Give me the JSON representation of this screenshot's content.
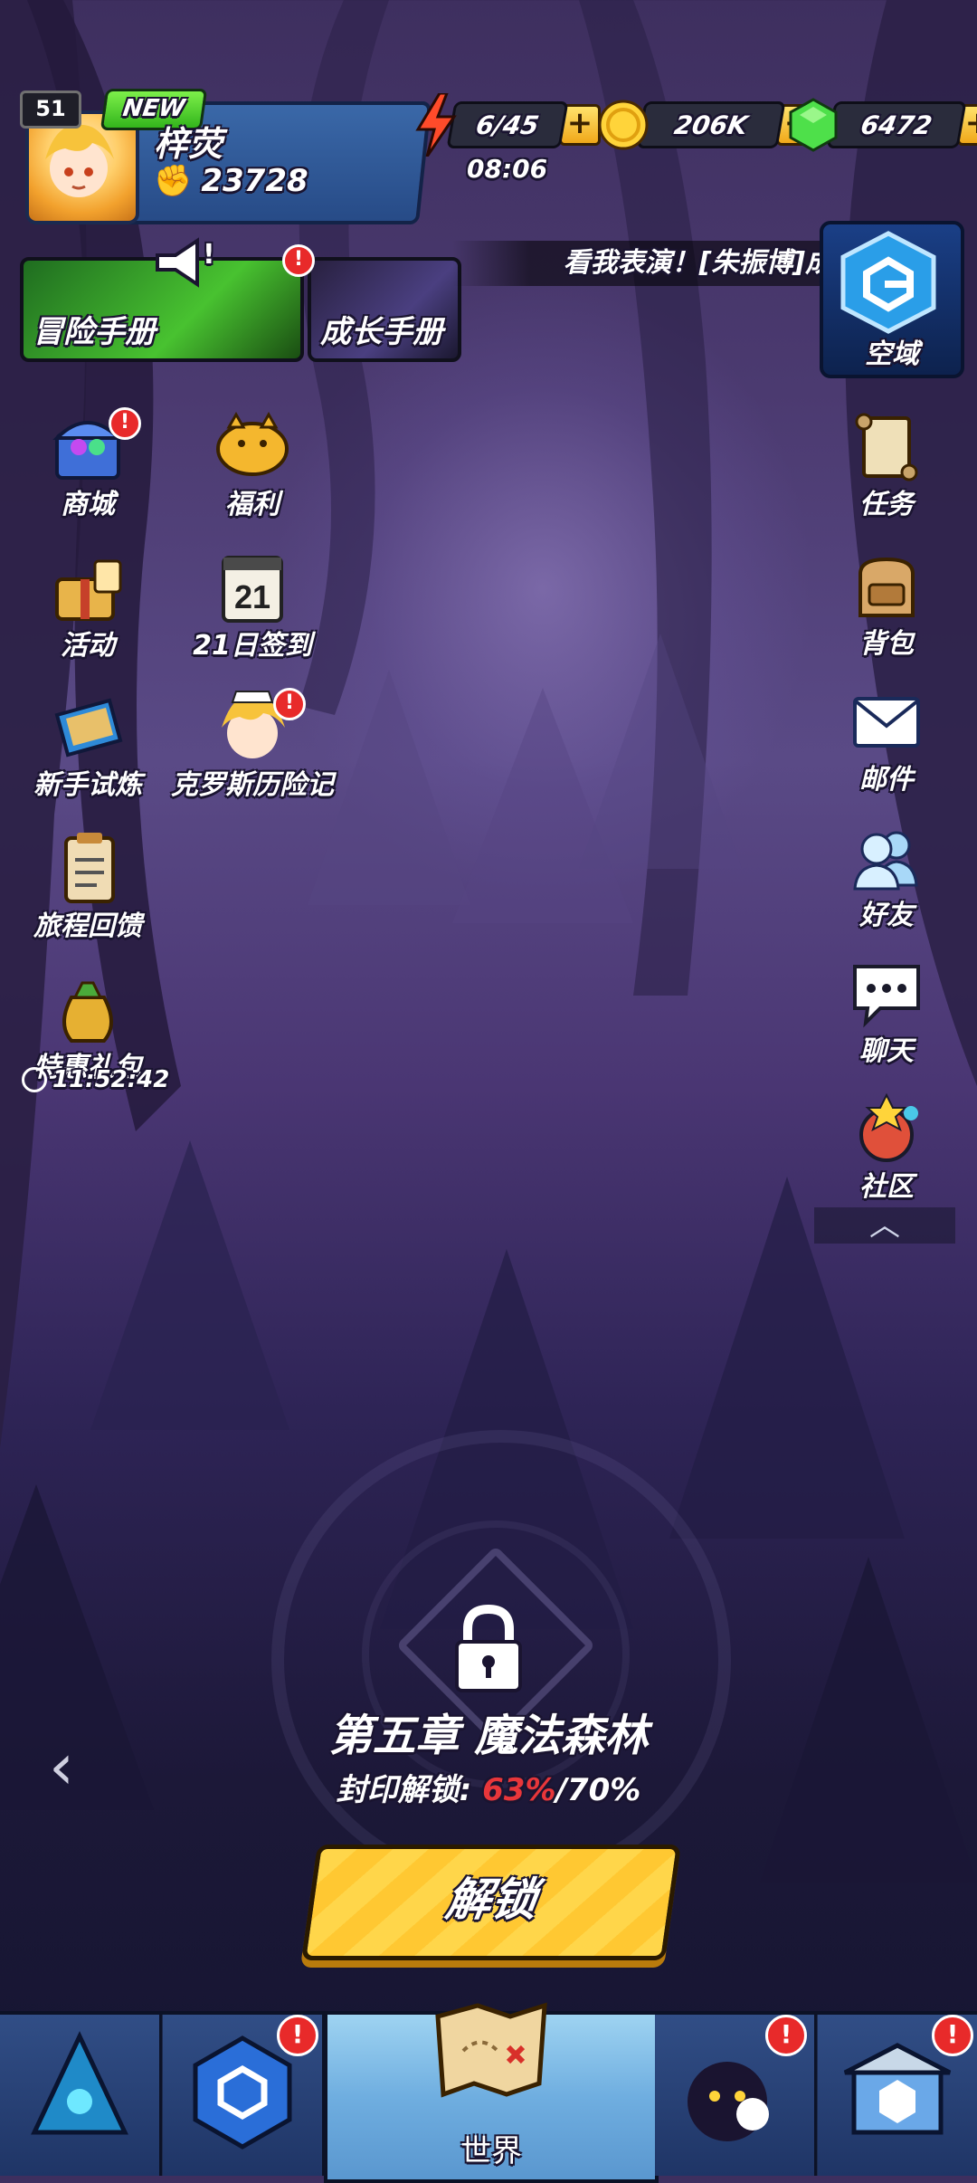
{
  "player": {
    "level": "51",
    "new_badge": "NEW",
    "name": "梓荧",
    "power": "23728"
  },
  "resources": {
    "stamina": "6/45",
    "stamina_timer": "08:06",
    "gold": "206K",
    "gems": "6472"
  },
  "handbooks": {
    "adventure": "冒险手册",
    "growth": "成长手册"
  },
  "announcement": {
    "text": "看我表演！[朱振博]成",
    "megaphone_mark": "!"
  },
  "skyzone": {
    "label": "空域"
  },
  "left_menu": [
    {
      "label": "商城",
      "icon": "treasure-chest-icon"
    },
    {
      "label": "福利",
      "icon": "piggy-bank-icon"
    },
    {
      "label": "活动",
      "icon": "gift-bag-icon"
    },
    {
      "label": "21日签到",
      "icon": "calendar-icon",
      "calendar_day": "21"
    },
    {
      "label": "新手试炼",
      "icon": "trial-book-icon"
    },
    {
      "label": "克罗斯历险记",
      "icon": "adventure-character-icon"
    },
    {
      "label": "旅程回馈",
      "icon": "clipboard-icon"
    },
    {
      "label": "特惠礼包",
      "icon": "money-bag-icon"
    }
  ],
  "gift_timer": "11:52:42",
  "right_menu": [
    {
      "label": "任务",
      "icon": "scroll-icon"
    },
    {
      "label": "背包",
      "icon": "backpack-icon"
    },
    {
      "label": "邮件",
      "icon": "mail-icon"
    },
    {
      "label": "好友",
      "icon": "friends-icon"
    },
    {
      "label": "聊天",
      "icon": "chat-icon"
    },
    {
      "label": "社区",
      "icon": "community-icon"
    }
  ],
  "badge_mark": "!",
  "collapse_glyph": "︿",
  "back_glyph": "‹",
  "chapter": {
    "title": "第五章 魔法森林",
    "seal_label": "封印解锁:",
    "seal_current": "63%",
    "seal_target": "/70%",
    "unlock_button": "解锁"
  },
  "bottom_nav": [
    {
      "icon": "crystal-guild-icon"
    },
    {
      "icon": "hex-shield-icon"
    },
    {
      "label": "世界",
      "icon": "treasure-map-icon"
    },
    {
      "icon": "shadow-hero-icon"
    },
    {
      "icon": "blue-shop-icon"
    }
  ],
  "colors": {
    "accent_gold": "#ffc832",
    "alert_red": "#e82a2a",
    "seal_red": "#e8363a",
    "new_green": "#33b51c"
  }
}
